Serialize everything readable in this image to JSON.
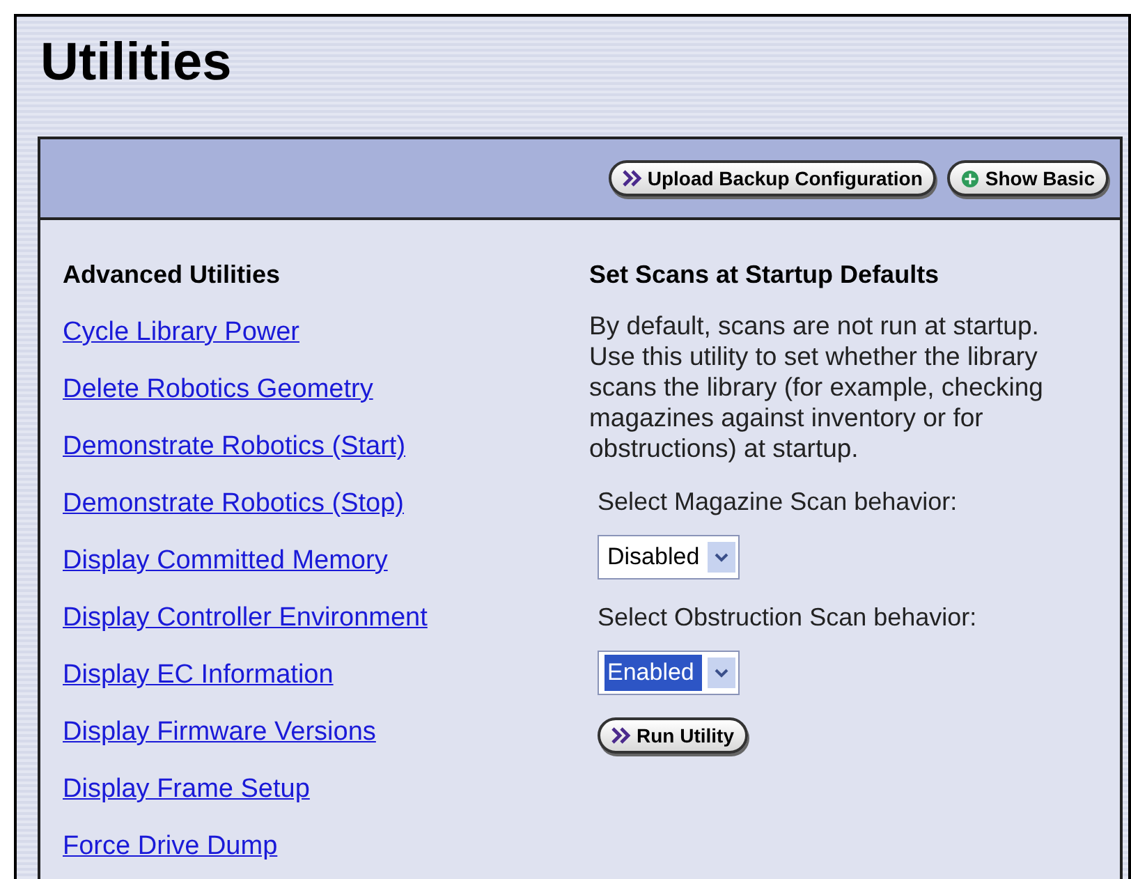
{
  "page": {
    "title": "Utilities"
  },
  "toolbar": {
    "buttons": [
      {
        "label": "Upload Backup Configuration",
        "kind": "arrow"
      },
      {
        "label": "Show Basic",
        "kind": "plus"
      }
    ]
  },
  "advanced_utilities": {
    "heading": "Advanced Utilities",
    "links": [
      "Cycle Library Power",
      "Delete Robotics Geometry",
      "Demonstrate Robotics (Start)",
      "Demonstrate Robotics (Stop)",
      "Display Committed Memory",
      "Display Controller Environment",
      "Display EC Information",
      "Display Firmware Versions",
      "Display Frame Setup",
      "Force Drive Dump"
    ]
  },
  "details": {
    "heading": "Set Scans at Startup Defaults",
    "description": "By default, scans are not run at startup. Use this utility to set whether the library scans the library (for example, checking magazines against inventory or for obstructions) at startup.",
    "fields": [
      {
        "label": "Select Magazine Scan behavior:",
        "value": "Disabled",
        "focused": false
      },
      {
        "label": "Select Obstruction Scan behavior:",
        "value": "Enabled",
        "focused": true
      }
    ],
    "run_button": {
      "label": "Run Utility",
      "kind": "arrow"
    }
  }
}
